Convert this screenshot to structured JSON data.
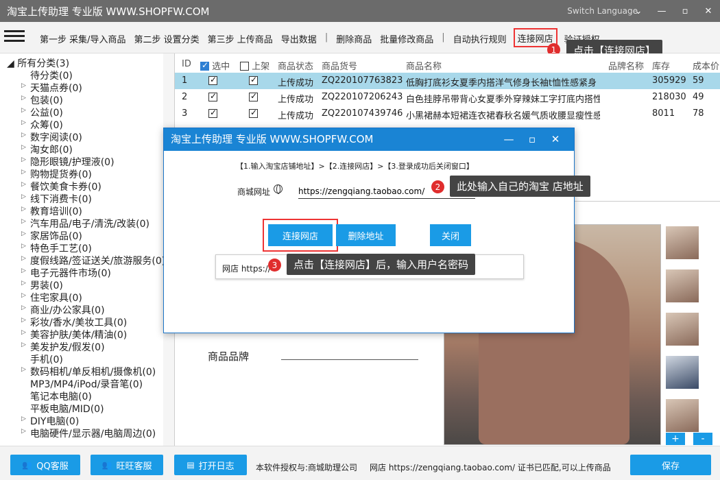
{
  "window": {
    "title": "淘宝上传助理 专业版 WWW.SHOPFW.COM",
    "switch_language": "Switch Language"
  },
  "toolbar": {
    "items": [
      "第一步 采集/导入商品",
      "第二步 设置分类",
      "第三步 上传商品",
      "导出数据",
      "删除商品",
      "批量修改商品",
      "自动执行规则",
      "连接网店",
      "验证授权"
    ]
  },
  "callouts": {
    "c1_num": "1",
    "c1_text": "点击【连接网店】",
    "c2_num": "2",
    "c2_text": "此处输入自己的淘宝 店地址",
    "c3_num": "3",
    "c3_text": "点击【连接网店】后，输入用户名密码"
  },
  "sidebar": {
    "root": "所有分类(3)",
    "items": [
      {
        "label": "待分类(0)",
        "arrow": false
      },
      {
        "label": "天猫点券(0)",
        "arrow": true
      },
      {
        "label": "包装(0)",
        "arrow": true
      },
      {
        "label": "公益(0)",
        "arrow": true
      },
      {
        "label": "众筹(0)",
        "arrow": true
      },
      {
        "label": "数字阅读(0)",
        "arrow": true
      },
      {
        "label": "淘女郎(0)",
        "arrow": true
      },
      {
        "label": "隐形眼镜/护理液(0)",
        "arrow": true
      },
      {
        "label": "购物提货券(0)",
        "arrow": true
      },
      {
        "label": "餐饮美食卡券(0)",
        "arrow": true
      },
      {
        "label": "线下消费卡(0)",
        "arrow": true
      },
      {
        "label": "教育培训(0)",
        "arrow": true
      },
      {
        "label": "汽车用品/电子/清洗/改装(0)",
        "arrow": true
      },
      {
        "label": "家居饰品(0)",
        "arrow": true
      },
      {
        "label": "特色手工艺(0)",
        "arrow": true
      },
      {
        "label": "度假线路/签证送关/旅游服务(0)",
        "arrow": true
      },
      {
        "label": "电子元器件市场(0)",
        "arrow": true
      },
      {
        "label": "男装(0)",
        "arrow": true
      },
      {
        "label": "住宅家具(0)",
        "arrow": true
      },
      {
        "label": "商业/办公家具(0)",
        "arrow": true
      },
      {
        "label": "彩妆/香水/美妆工具(0)",
        "arrow": true
      },
      {
        "label": "美容护肤/美体/精油(0)",
        "arrow": true
      },
      {
        "label": "美发护发/假发(0)",
        "arrow": true
      },
      {
        "label": "手机(0)",
        "arrow": false
      },
      {
        "label": "数码相机/单反相机/摄像机(0)",
        "arrow": true
      },
      {
        "label": "MP3/MP4/iPod/录音笔(0)",
        "arrow": false
      },
      {
        "label": "笔记本电脑(0)",
        "arrow": false
      },
      {
        "label": "平板电脑/MID(0)",
        "arrow": false
      },
      {
        "label": "DIY电脑(0)",
        "arrow": true
      },
      {
        "label": "电脑硬件/显示器/电脑周边(0)",
        "arrow": true
      }
    ]
  },
  "grid": {
    "headers": {
      "id": "ID",
      "selected": "选中",
      "listed": "上架",
      "status": "商品状态",
      "sku": "商品货号",
      "name": "商品名称",
      "brand": "品牌名称",
      "stock": "库存",
      "cost": "成本价"
    },
    "rows": [
      {
        "id": "1",
        "selected": true,
        "listed": true,
        "status": "上传成功",
        "sku": "ZQ220107763823",
        "name": "低胸打底衫女夏季内搭洋气修身长袖t恤性感紧身",
        "stock": "305929",
        "cost": "59"
      },
      {
        "id": "2",
        "selected": true,
        "listed": true,
        "status": "上传成功",
        "sku": "ZQ220107206243",
        "name": "白色挂脖吊带背心女夏季外穿辣妹工字打底内搭性",
        "stock": "218030",
        "cost": "49"
      },
      {
        "id": "3",
        "selected": true,
        "listed": true,
        "status": "上传成功",
        "sku": "ZQ220107439746",
        "name": "小黑裙赫本短裙连衣裙春秋名媛气质收腰显瘦性感",
        "stock": "8011",
        "cost": "78"
      }
    ]
  },
  "detail": {
    "brand_label": "商品品牌",
    "plus": "+",
    "minus": "-"
  },
  "dialog": {
    "title": "淘宝上传助理 专业版 WWW.SHOPFW.COM",
    "steps": "【1.输入淘宝店铺地址】>【2.连接网店】>【3.登录成功后关闭窗口】",
    "url_label": "商城网址",
    "url_value": "https://zengqiang.taobao.com/",
    "connect_btn": "连接网店",
    "delete_btn": "删除地址",
    "close_btn": "关闭",
    "shop_prefix": "网店 https://"
  },
  "statusbar": {
    "qq": "QQ客服",
    "wangwang": "旺旺客服",
    "log": "打开日志",
    "license": "本软件授权与:商城助理公司",
    "shop_status": "网店 https://zengqiang.taobao.com/ 证书已匹配,可以上传商品",
    "save": "保存"
  }
}
